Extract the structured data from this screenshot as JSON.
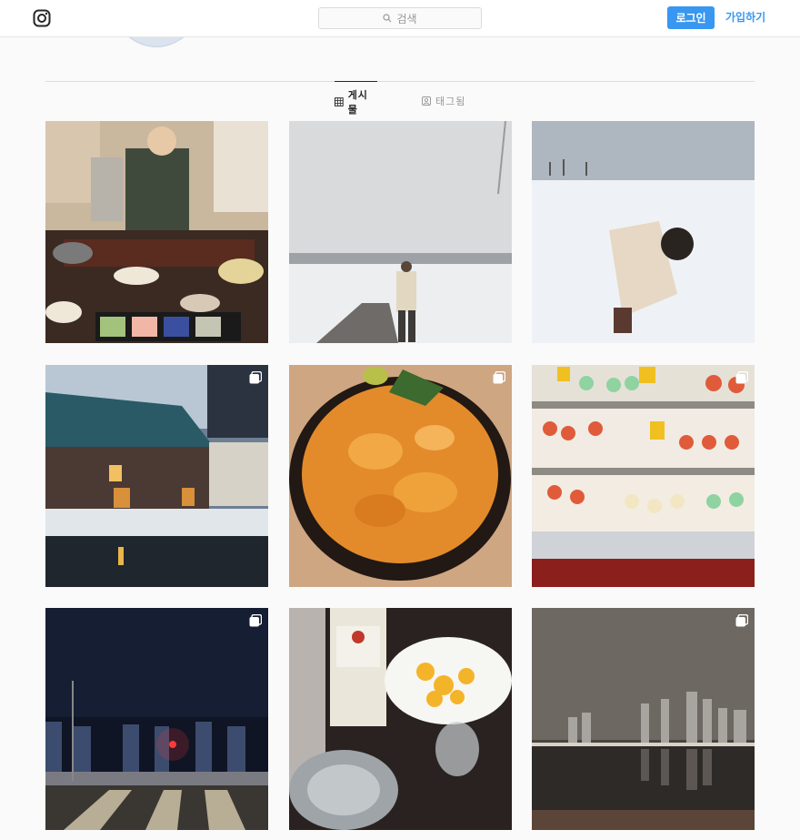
{
  "nav": {
    "logo_icon": "instagram-icon",
    "search_placeholder": "검색",
    "search_icon": "search-icon",
    "login_label": "로그인",
    "signup_label": "가입하기"
  },
  "tabs": [
    {
      "label": "게시물",
      "icon": "grid-icon",
      "active": true
    },
    {
      "label": "태그됨",
      "icon": "tagged-icon",
      "active": false
    }
  ],
  "posts": [
    {
      "subject": "person praying at Japanese meal",
      "multi": false
    },
    {
      "subject": "person standing in snowy field",
      "multi": false
    },
    {
      "subject": "person kneeling in snow",
      "multi": false
    },
    {
      "subject": "brick warehouse by canal",
      "multi": true
    },
    {
      "subject": "sea urchin rice bowl",
      "multi": true
    },
    {
      "subject": "sushi display case",
      "multi": true
    },
    {
      "subject": "city skyline at night crosswalk",
      "multi": true
    },
    {
      "subject": "bacardi bottle and fruit plate",
      "multi": false
    },
    {
      "subject": "foggy city skyline over water",
      "multi": true
    }
  ],
  "colors": {
    "accent": "#3897f0",
    "border": "#dbdbdb",
    "background": "#fafafa"
  }
}
